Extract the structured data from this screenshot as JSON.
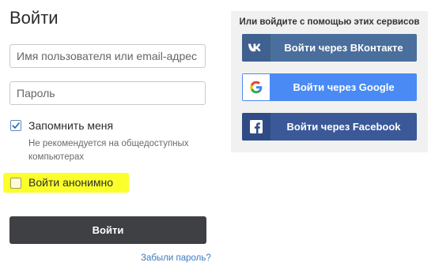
{
  "login": {
    "title": "Войти",
    "username_placeholder": "Имя пользователя или email-адрес",
    "password_placeholder": "Пароль",
    "remember_label": "Запомнить меня",
    "remember_checked": true,
    "remember_hint": "Не рекомендуется на общедоступных компьютерах",
    "anonymous_label": "Войти анонимно",
    "anonymous_checked": false,
    "submit_label": "Войти",
    "forgot_link": "Забыли пароль?"
  },
  "social": {
    "title": "Или войдите с помощью этих сервисов",
    "buttons": [
      {
        "label": "Войти через ВКонтакте",
        "icon": "vk-icon",
        "color": "#4a6f9d"
      },
      {
        "label": "Войти через Google",
        "icon": "google-icon",
        "color": "#4a8af4"
      },
      {
        "label": "Войти через Facebook",
        "icon": "facebook-icon",
        "color": "#3b5998"
      }
    ]
  },
  "colors": {
    "highlight": "#fbff2a",
    "submit_bg": "#3e4044",
    "link": "#3e7bbf"
  }
}
